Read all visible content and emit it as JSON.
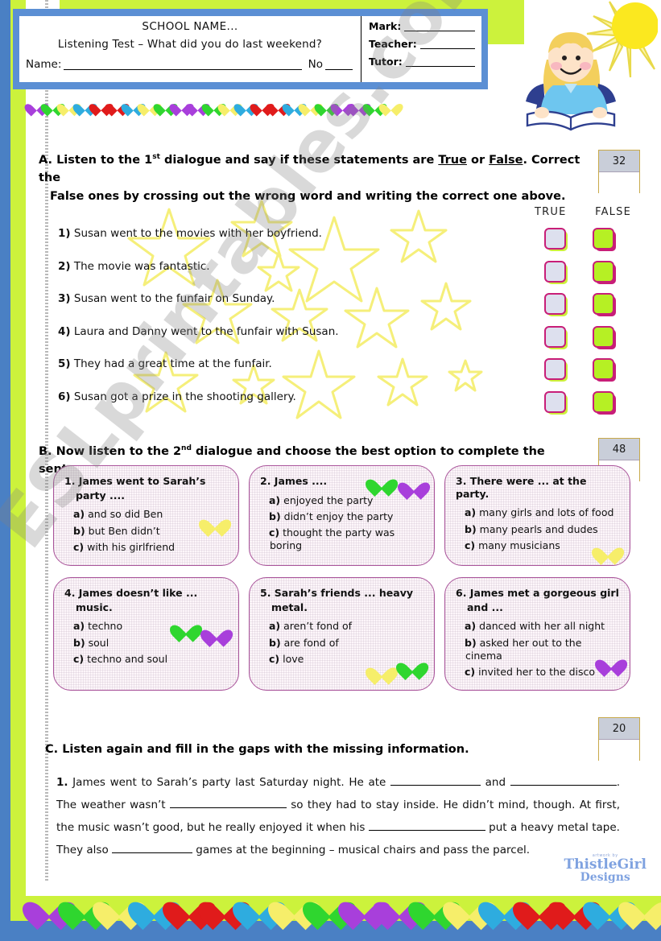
{
  "header": {
    "school_name": "SCHOOL NAME...",
    "test_title": "Listening Test – What did you do last weekend?",
    "name_label": "Name:",
    "no_label": "No",
    "mark_label": "Mark:",
    "teacher_label": "Teacher:",
    "tutor_label": "Tutor:"
  },
  "watermark": {
    "text": "ESLprintables.com"
  },
  "sections": {
    "a": {
      "heading_line1": "A. Listen to the 1st dialogue and say if these statements are True or False. Correct the",
      "heading_line2": "False ones by crossing out the wrong word and writing the correct one above.",
      "letter": "A.",
      "part1": "Listen to the 1",
      "sup": "st",
      "part2": " dialogue and say if these statements are ",
      "true_word": "True",
      "or_word": " or ",
      "false_word": "False",
      "part3": ". Correct the",
      "line2": "False ones by crossing out the wrong word and writing the correct one above.",
      "score": "32",
      "col_true": "TRUE",
      "col_false": "FALSE",
      "statements": [
        {
          "num": "1)",
          "text": "Susan went to the movies with her boyfriend."
        },
        {
          "num": "2)",
          "text": "The movie was fantastic."
        },
        {
          "num": "3)",
          "text": "Susan went to the funfair on Sunday."
        },
        {
          "num": "4)",
          "text": "Laura and Danny went to the funfair with Susan."
        },
        {
          "num": "5)",
          "text": "They had a great time at the funfair."
        },
        {
          "num": "6)",
          "text": "Susan got a prize in the shooting gallery."
        }
      ]
    },
    "b": {
      "letter": "B.",
      "part1": "Now listen to the 2",
      "sup": "nd",
      "part2": " dialogue and choose the best option to complete the sentences.",
      "score": "48",
      "cards": [
        {
          "question_line1": "1. James went to Sarah’s",
          "question_line2": "party ....",
          "options": [
            {
              "letter": "a)",
              "text": " and so did Ben"
            },
            {
              "letter": "b)",
              "text": " but Ben didn’t"
            },
            {
              "letter": "c)",
              "text": " with his girlfriend"
            }
          ]
        },
        {
          "question_line1": "2. James ....",
          "question_line2": "",
          "options": [
            {
              "letter": "a)",
              "text": " enjoyed the party"
            },
            {
              "letter": "b)",
              "text": " didn’t enjoy the party"
            },
            {
              "letter": "c)",
              "text": " thought the party was boring"
            }
          ]
        },
        {
          "question_line1": "3. There were ... at the party.",
          "question_line2": "",
          "options": [
            {
              "letter": "a)",
              "text": " many girls and lots of food"
            },
            {
              "letter": "b)",
              "text": " many pearls and dudes"
            },
            {
              "letter": "c)",
              "text": " many musicians"
            }
          ]
        },
        {
          "question_line1": "4. James doesn’t like ...",
          "question_line2": "music.",
          "options": [
            {
              "letter": "a)",
              "text": " techno"
            },
            {
              "letter": "b)",
              "text": " soul"
            },
            {
              "letter": "c)",
              "text": " techno and soul"
            }
          ]
        },
        {
          "question_line1": "5. Sarah’s friends ... heavy",
          "question_line2": "metal.",
          "options": [
            {
              "letter": "a)",
              "text": " aren’t fond of"
            },
            {
              "letter": "b)",
              "text": " are fond of"
            },
            {
              "letter": "c)",
              "text": " love"
            }
          ]
        },
        {
          "question_line1": "6. James met a gorgeous girl",
          "question_line2": "and  ...",
          "options": [
            {
              "letter": "a)",
              "text": " danced with her all night"
            },
            {
              "letter": "b)",
              "text": " asked her out to the cinema"
            },
            {
              "letter": "c)",
              "text": " invited her to the disco"
            }
          ]
        }
      ]
    },
    "c": {
      "heading": "C. Listen again and fill in the gaps with the missing information.",
      "score": "20",
      "gap_text": {
        "num": "1.",
        "t1": " James went to Sarah’s party last Saturday night. He ate ",
        "t2": " and ",
        "t3": ". The weather wasn’t ",
        "t4": " so they had to stay inside. He didn’t mind, though. At first, the music wasn’t good, but he really enjoyed it when his ",
        "t5": " put a heavy metal tape. They also ",
        "t6": " games at the beginning – musical chairs and pass the parcel."
      }
    }
  },
  "logo": {
    "top": "artwork by",
    "main": "ThistleGirl",
    "sub": "Designs"
  },
  "colors": {
    "blue_border": "#4a80c4",
    "lime_border": "#ccf23c",
    "header_frame": "#5b8fd4",
    "card_border": "#a9539a",
    "checkbox_border": "#c81e78",
    "false_green": "#b6f024",
    "true_lavender": "#dde0ee",
    "score_header": "#c9ced9",
    "score_border": "#c8a94a"
  }
}
